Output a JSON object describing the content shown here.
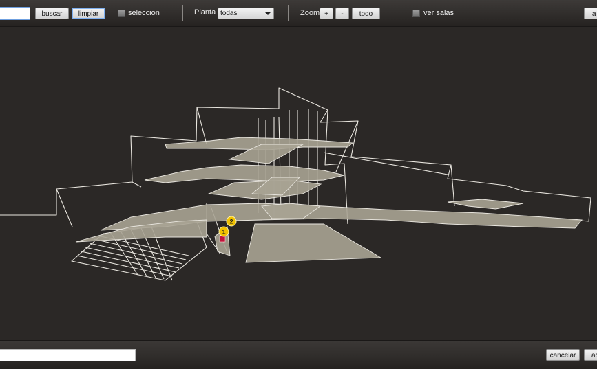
{
  "toolbar": {
    "search_label": "buscar",
    "clear_label": "limpiar",
    "selection_label": "seleccion",
    "floor_label": "Planta",
    "floor_value": "todas",
    "zoom_label": "Zoom",
    "zoom_in_label": "+",
    "zoom_out_label": "-",
    "zoom_all_label": "todo",
    "show_rooms_label": "ver salas",
    "right_button_label": "a"
  },
  "markers": [
    {
      "label": "1",
      "color": "#f2c200"
    },
    {
      "label": "2",
      "color": "#f2c200"
    }
  ],
  "footer": {
    "cancel_label": "cancelar",
    "accept_label": "ac"
  },
  "colors": {
    "background": "#2b2826",
    "floor_fill": "#a8a394",
    "outline": "#e9e6df",
    "marker": "#f2c200",
    "location_pin": "#c0143c"
  }
}
